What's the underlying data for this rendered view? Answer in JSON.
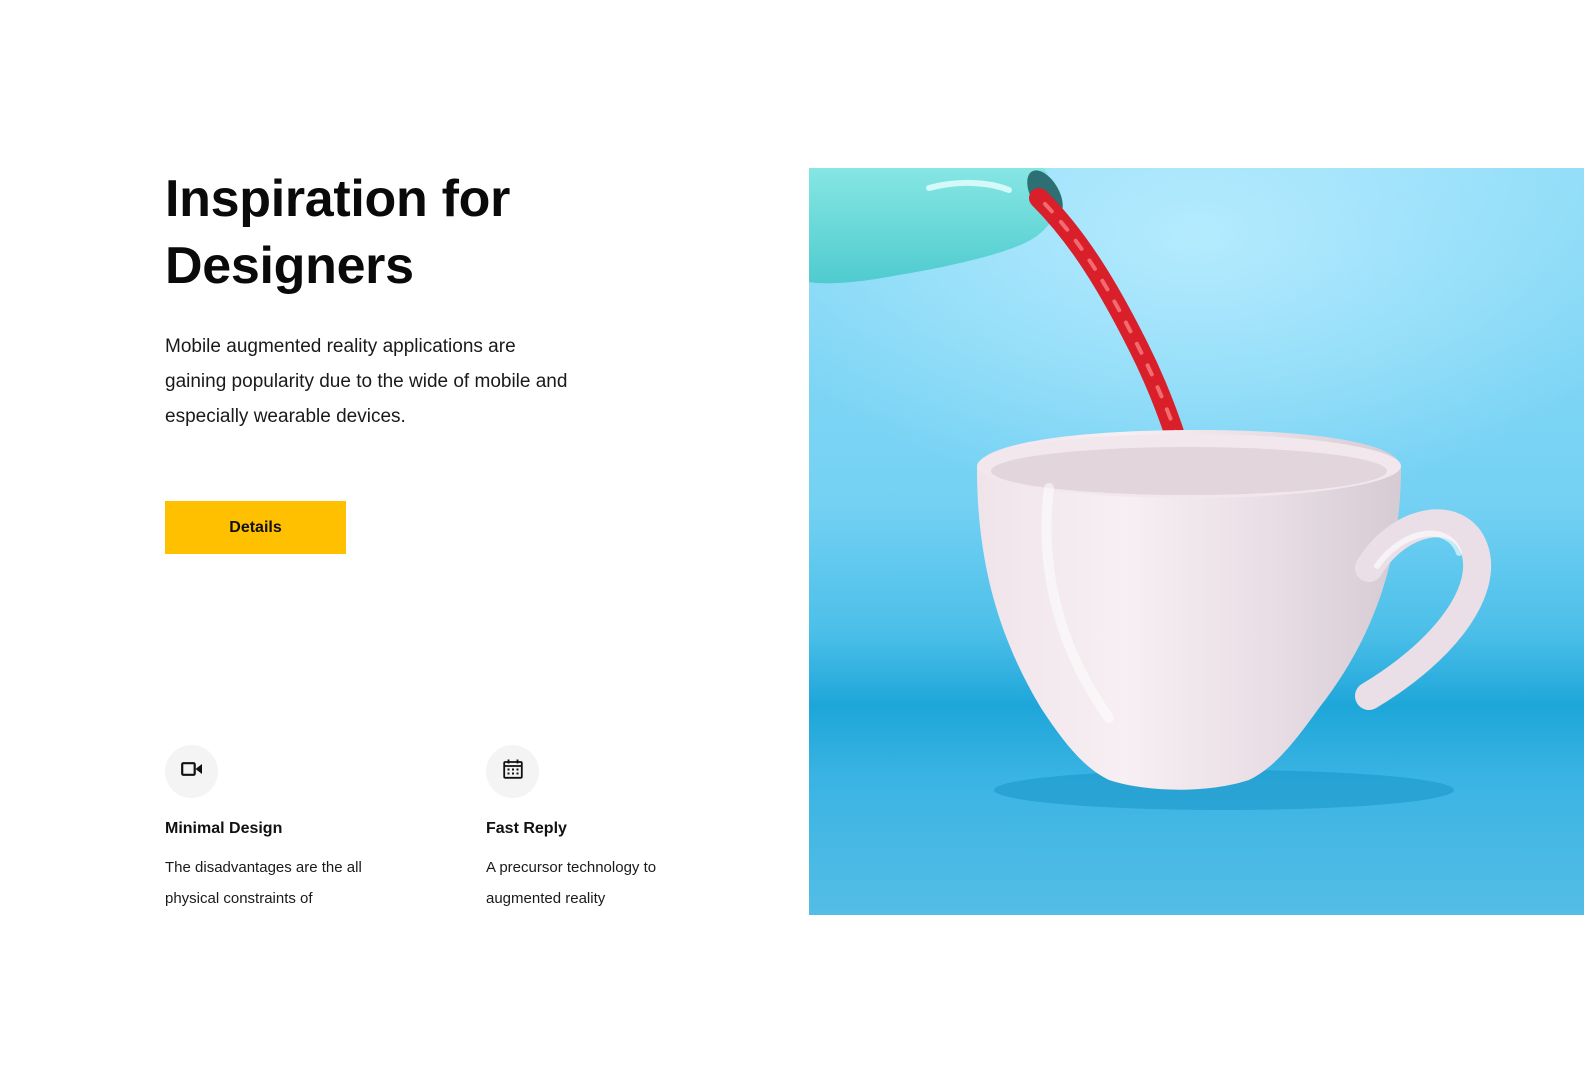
{
  "hero": {
    "title_line1": "Inspiration for",
    "title_line2": "Designers",
    "description": "Mobile augmented reality applications are gaining popularity due to the wide of mobile and especially wearable devices.",
    "button_label": "Details"
  },
  "features": [
    {
      "icon": "video-camera-icon",
      "title": "Minimal Design",
      "text": "The disadvantages are the all physical constraints of"
    },
    {
      "icon": "calendar-icon",
      "title": "Fast Reply",
      "text": "A precursor technology to augmented reality"
    }
  ],
  "photo": {
    "subject": "teapot-pouring-red-licorice-into-cup"
  },
  "colors": {
    "accent": "#ffc000",
    "photo_background": "#5cc3ea",
    "icon_background": "#f4f4f4"
  }
}
